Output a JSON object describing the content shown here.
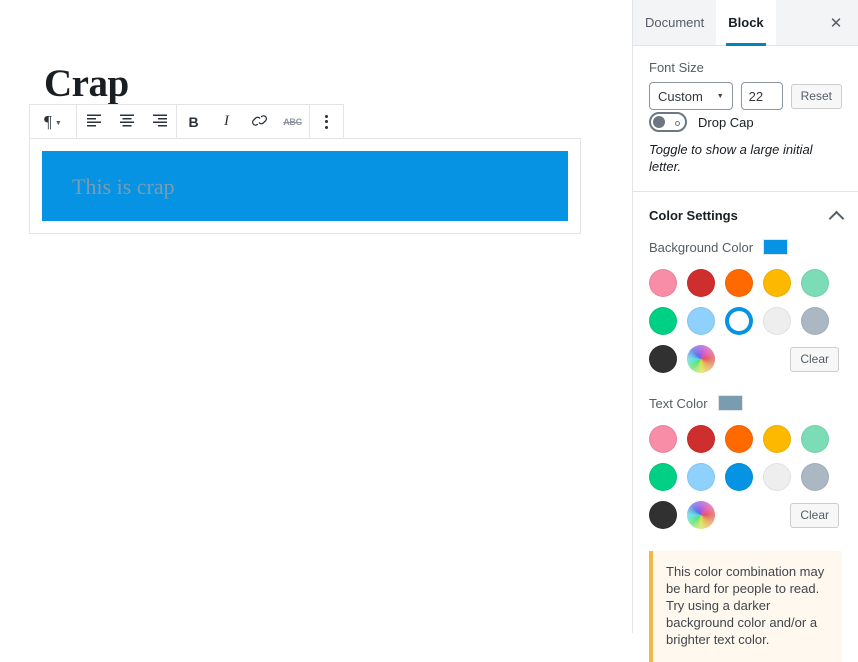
{
  "editor": {
    "post_title": "Crap",
    "toolbar": {
      "block_type_label": "¶",
      "block_type_caret": "▾",
      "align_left_label": "",
      "align_center_label": "",
      "align_right_label": "",
      "bold_label": "B",
      "italic_label": "I",
      "link_label": "",
      "strikethrough_label": "ABC",
      "more_options_label": ""
    },
    "paragraph": {
      "text": "This is crap",
      "background_color": "#0693e3",
      "text_color": "#7a9cb0"
    }
  },
  "sidebar": {
    "tabs": [
      {
        "label": "Document",
        "active": false
      },
      {
        "label": "Block",
        "active": true
      }
    ],
    "close_label": "✕",
    "font_size": {
      "label": "Font Size",
      "select_value": "Custom",
      "select_caret": "▼",
      "number_value": "22",
      "reset_label": "Reset"
    },
    "drop_cap": {
      "label": "Drop Cap",
      "enabled": false,
      "help_text": "Toggle to show a large initial letter."
    },
    "color_settings": {
      "title": "Color Settings",
      "expanded": true,
      "background": {
        "label": "Background Color",
        "current": "#0693e3",
        "clear_label": "Clear",
        "swatches": [
          {
            "name": "pale-pink",
            "color": "#f78da7",
            "selected": false
          },
          {
            "name": "vivid-red",
            "color": "#cf2e2e",
            "selected": false
          },
          {
            "name": "luminous-vivid-orange",
            "color": "#ff6900",
            "selected": false
          },
          {
            "name": "luminous-vivid-amber",
            "color": "#fcb900",
            "selected": false
          },
          {
            "name": "light-green-cyan",
            "color": "#7bdcb5",
            "selected": false
          },
          {
            "name": "vivid-green-cyan",
            "color": "#00d084",
            "selected": false
          },
          {
            "name": "pale-cyan-blue",
            "color": "#8ed1fc",
            "selected": false
          },
          {
            "name": "vivid-cyan-blue",
            "color": "#0693e3",
            "selected": true
          },
          {
            "name": "very-light-gray",
            "color": "#eeeeee",
            "selected": false
          },
          {
            "name": "cyan-bluish-gray",
            "color": "#abb8c3",
            "selected": false
          },
          {
            "name": "very-dark-gray",
            "color": "#313131",
            "selected": false
          },
          {
            "name": "custom-color-wheel",
            "color": "wheel",
            "selected": false
          }
        ]
      },
      "text": {
        "label": "Text Color",
        "current": "#7a9cb0",
        "clear_label": "Clear",
        "swatches": [
          {
            "name": "pale-pink",
            "color": "#f78da7",
            "selected": false
          },
          {
            "name": "vivid-red",
            "color": "#cf2e2e",
            "selected": false
          },
          {
            "name": "luminous-vivid-orange",
            "color": "#ff6900",
            "selected": false
          },
          {
            "name": "luminous-vivid-amber",
            "color": "#fcb900",
            "selected": false
          },
          {
            "name": "light-green-cyan",
            "color": "#7bdcb5",
            "selected": false
          },
          {
            "name": "vivid-green-cyan",
            "color": "#00d084",
            "selected": false
          },
          {
            "name": "pale-cyan-blue",
            "color": "#8ed1fc",
            "selected": false
          },
          {
            "name": "vivid-cyan-blue",
            "color": "#0693e3",
            "selected": false
          },
          {
            "name": "very-light-gray",
            "color": "#eeeeee",
            "selected": false
          },
          {
            "name": "cyan-bluish-gray",
            "color": "#abb8c3",
            "selected": false
          },
          {
            "name": "very-dark-gray",
            "color": "#313131",
            "selected": false
          },
          {
            "name": "custom-color-wheel",
            "color": "wheel",
            "selected": false
          }
        ]
      },
      "contrast_notice": "This color combination may be hard for people to read. Try using a darker background color and/or a brighter text color."
    },
    "accent_color": "#0085ba",
    "notice_border_color": "#f0b849",
    "notice_background_color": "#fef8ee"
  }
}
